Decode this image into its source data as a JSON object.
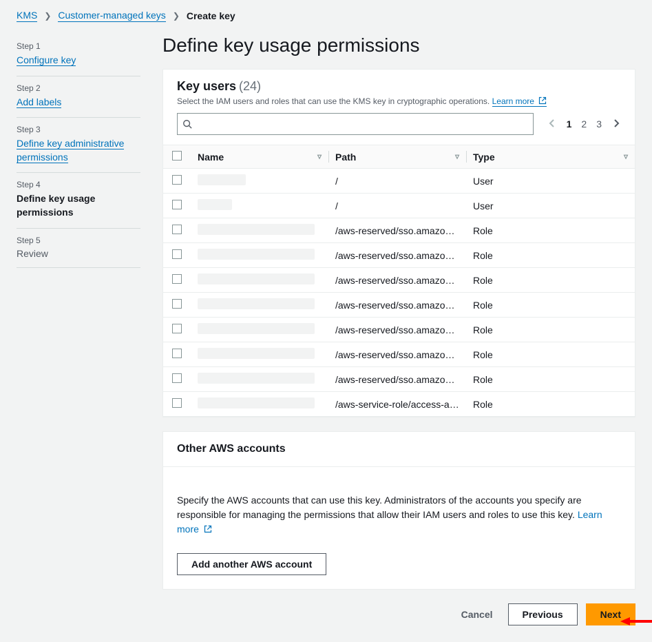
{
  "breadcrumb": {
    "root": "KMS",
    "mid": "Customer-managed keys",
    "current": "Create key"
  },
  "sidebar": {
    "steps": [
      {
        "label": "Step 1",
        "title": "Configure key",
        "link": true,
        "active": false
      },
      {
        "label": "Step 2",
        "title": "Add labels",
        "link": true,
        "active": false
      },
      {
        "label": "Step 3",
        "title": "Define key administrative permissions",
        "link": true,
        "active": false
      },
      {
        "label": "Step 4",
        "title": "Define key usage permissions",
        "link": false,
        "active": true
      },
      {
        "label": "Step 5",
        "title": "Review",
        "link": false,
        "active": false
      }
    ]
  },
  "pageTitle": "Define key usage permissions",
  "keyUsers": {
    "title": "Key users",
    "count": "(24)",
    "desc": "Select the IAM users and roles that can use the KMS key in cryptographic operations.",
    "learnMore": "Learn more",
    "columns": {
      "name": "Name",
      "path": "Path",
      "type": "Type"
    },
    "pages": [
      "1",
      "2",
      "3"
    ],
    "rows": [
      {
        "nameW": 70,
        "path": "/",
        "type": "User"
      },
      {
        "nameW": 50,
        "path": "/",
        "type": "User"
      },
      {
        "nameW": 170,
        "path": "/aws-reserved/sso.amazonaws…",
        "type": "Role"
      },
      {
        "nameW": 170,
        "path": "/aws-reserved/sso.amazonaws…",
        "type": "Role"
      },
      {
        "nameW": 170,
        "path": "/aws-reserved/sso.amazonaws…",
        "type": "Role"
      },
      {
        "nameW": 170,
        "path": "/aws-reserved/sso.amazonaws…",
        "type": "Role"
      },
      {
        "nameW": 170,
        "path": "/aws-reserved/sso.amazonaws…",
        "type": "Role"
      },
      {
        "nameW": 170,
        "path": "/aws-reserved/sso.amazonaws…",
        "type": "Role"
      },
      {
        "nameW": 170,
        "path": "/aws-reserved/sso.amazonaws…",
        "type": "Role"
      },
      {
        "nameW": 170,
        "path": "/aws-service-role/access-analy…",
        "type": "Role"
      }
    ]
  },
  "otherAccounts": {
    "title": "Other AWS accounts",
    "desc": "Specify the AWS accounts that can use this key. Administrators of the accounts you specify are responsible for managing the permissions that allow their IAM users and roles to use this key.",
    "learnMore": "Learn more",
    "addBtn": "Add another AWS account"
  },
  "footer": {
    "cancel": "Cancel",
    "previous": "Previous",
    "next": "Next"
  }
}
